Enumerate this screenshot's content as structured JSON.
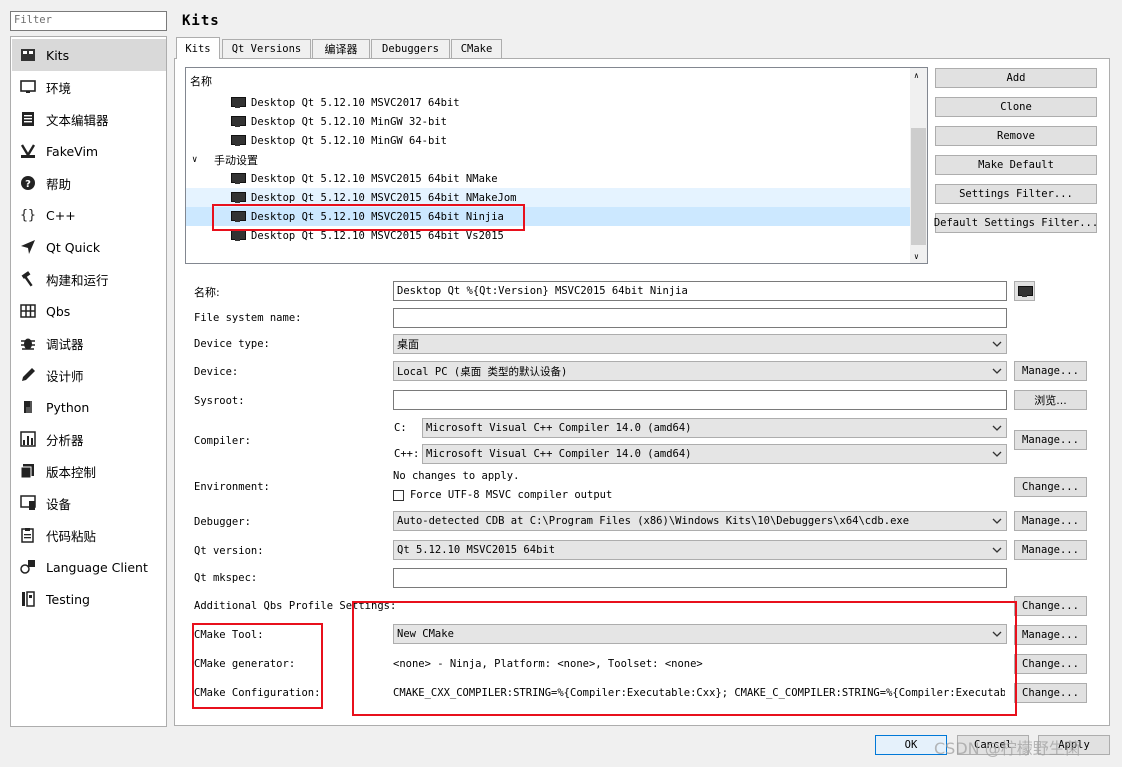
{
  "filter": {
    "placeholder": "Filter"
  },
  "sidebar": {
    "items": [
      {
        "label": "Kits",
        "icon": "kits-icon"
      },
      {
        "label": "环境",
        "icon": "monitor-icon"
      },
      {
        "label": "文本编辑器",
        "icon": "text-editor-icon"
      },
      {
        "label": "FakeVim",
        "icon": "fakevim-icon"
      },
      {
        "label": "帮助",
        "icon": "help-icon"
      },
      {
        "label": "C++",
        "icon": "braces-icon"
      },
      {
        "label": "Qt Quick",
        "icon": "qtquick-icon"
      },
      {
        "label": "构建和运行",
        "icon": "hammer-icon"
      },
      {
        "label": "Qbs",
        "icon": "grid-icon"
      },
      {
        "label": "调试器",
        "icon": "bug-icon"
      },
      {
        "label": "设计师",
        "icon": "pencil-icon"
      },
      {
        "label": "Python",
        "icon": "python-icon"
      },
      {
        "label": "分析器",
        "icon": "analyzer-icon"
      },
      {
        "label": "版本控制",
        "icon": "version-control-icon"
      },
      {
        "label": "设备",
        "icon": "device-icon"
      },
      {
        "label": "代码粘贴",
        "icon": "paste-icon"
      },
      {
        "label": "Language Client",
        "icon": "language-client-icon"
      },
      {
        "label": "Testing",
        "icon": "testing-icon"
      }
    ]
  },
  "page_title": "Kits",
  "tabs": [
    "Kits",
    "Qt Versions",
    "编译器",
    "Debuggers",
    "CMake"
  ],
  "tree": {
    "header": "名称",
    "items_top": [
      "Desktop Qt 5.12.10 MSVC2017 64bit",
      "Desktop Qt 5.12.10 MinGW 32-bit",
      "Desktop Qt 5.12.10 MinGW 64-bit"
    ],
    "group": "手动设置",
    "items_manual": [
      "Desktop Qt 5.12.10 MSVC2015 64bit NMake",
      "Desktop Qt 5.12.10 MSVC2015 64bit NMakeJom",
      "Desktop Qt 5.12.10 MSVC2015 64bit Ninjia",
      "Desktop Qt 5.12.10 MSVC2015 64bit Vs2015"
    ]
  },
  "side_buttons": [
    "Add",
    "Clone",
    "Remove",
    "Make Default",
    "Settings Filter...",
    "Default Settings Filter..."
  ],
  "form": {
    "name_label": "名称:",
    "name_value": "Desktop Qt %{Qt:Version} MSVC2015 64bit Ninjia",
    "fs_label": "File system name:",
    "devtype_label": "Device type:",
    "devtype_value": "桌面",
    "device_label": "Device:",
    "device_value": "Local PC (桌面 类型的默认设备)",
    "sysroot_label": "Sysroot:",
    "compiler_label": "Compiler:",
    "c_label": "C:",
    "c_value": "Microsoft Visual C++ Compiler 14.0 (amd64)",
    "cpp_label": "C++:",
    "cpp_value": "Microsoft Visual C++ Compiler 14.0 (amd64)",
    "env_label": "Environment:",
    "env_value": "No changes to apply.",
    "utf8_label": "Force UTF-8 MSVC compiler output",
    "debugger_label": "Debugger:",
    "debugger_value": "Auto-detected CDB at C:\\Program Files (x86)\\Windows Kits\\10\\Debuggers\\x64\\cdb.exe",
    "qtver_label": "Qt version:",
    "qtver_value": "Qt 5.12.10 MSVC2015 64bit",
    "mkspec_label": "Qt mkspec:",
    "qbs_label": "Additional Qbs Profile Settings:",
    "cmake_tool_label": "CMake Tool:",
    "cmake_tool_value": "New CMake",
    "cmake_gen_label": "CMake generator:",
    "cmake_gen_value": "<none> - Ninja, Platform: <none>, Toolset: <none>",
    "cmake_conf_label": "CMake Configuration:",
    "cmake_conf_value": "CMAKE_CXX_COMPILER:STRING=%{Compiler:Executable:Cxx}; CMAKE_C_COMPILER:STRING=%{Compiler:Executable:…"
  },
  "buttons": {
    "manage": "Manage...",
    "browse": "浏览...",
    "change": "Change..."
  },
  "footer": {
    "ok": "OK",
    "cancel": "Cancel",
    "apply": "Apply"
  },
  "watermark": "CSDN @柠檬野生菌",
  "colors": {
    "highlight": "#e8101c",
    "selection": "#cce8ff",
    "hover": "#e5f3ff"
  }
}
